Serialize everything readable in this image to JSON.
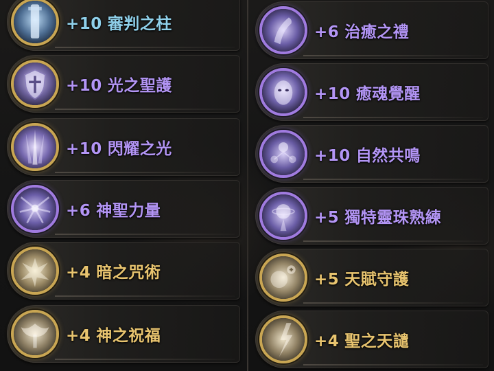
{
  "left_column": [
    {
      "level": "+10",
      "name": "審判之柱",
      "color": "#8fd0ea",
      "frame": "gold",
      "icon": "pillar-of-judgment-icon"
    },
    {
      "level": "+10",
      "name": "光之聖護",
      "color": "#b395f5",
      "frame": "gold",
      "icon": "holy-shield-icon"
    },
    {
      "level": "+10",
      "name": "閃耀之光",
      "color": "#b395f5",
      "frame": "gold",
      "icon": "shining-light-icon"
    },
    {
      "level": "+6",
      "name": "神聖力量",
      "color": "#b395f5",
      "frame": "purple",
      "icon": "holy-power-icon"
    },
    {
      "level": "+4",
      "name": "暗之咒術",
      "color": "#e8c46f",
      "frame": "gold",
      "icon": "dark-curse-icon"
    },
    {
      "level": "+4",
      "name": "神之祝福",
      "color": "#e8c46f",
      "frame": "gold",
      "icon": "divine-blessing-icon"
    }
  ],
  "right_column": [
    {
      "level": "+6",
      "name": "治癒之禮",
      "color": "#b395f5",
      "frame": "purple",
      "icon": "healing-gift-icon"
    },
    {
      "level": "+10",
      "name": "癒魂覺醒",
      "color": "#b395f5",
      "frame": "purple",
      "icon": "soul-awakening-icon"
    },
    {
      "level": "+10",
      "name": "自然共鳴",
      "color": "#b395f5",
      "frame": "purple",
      "icon": "nature-resonance-icon"
    },
    {
      "level": "+5",
      "name": "獨特靈珠熟練",
      "color": "#b395f5",
      "frame": "purple",
      "icon": "spirit-orb-icon"
    },
    {
      "level": "+5",
      "name": "天賦守護",
      "color": "#e8c46f",
      "frame": "gold",
      "icon": "talent-guardian-icon"
    },
    {
      "level": "+4",
      "name": "聖之天譴",
      "color": "#e8c46f",
      "frame": "gold",
      "icon": "holy-judgment-icon"
    }
  ]
}
